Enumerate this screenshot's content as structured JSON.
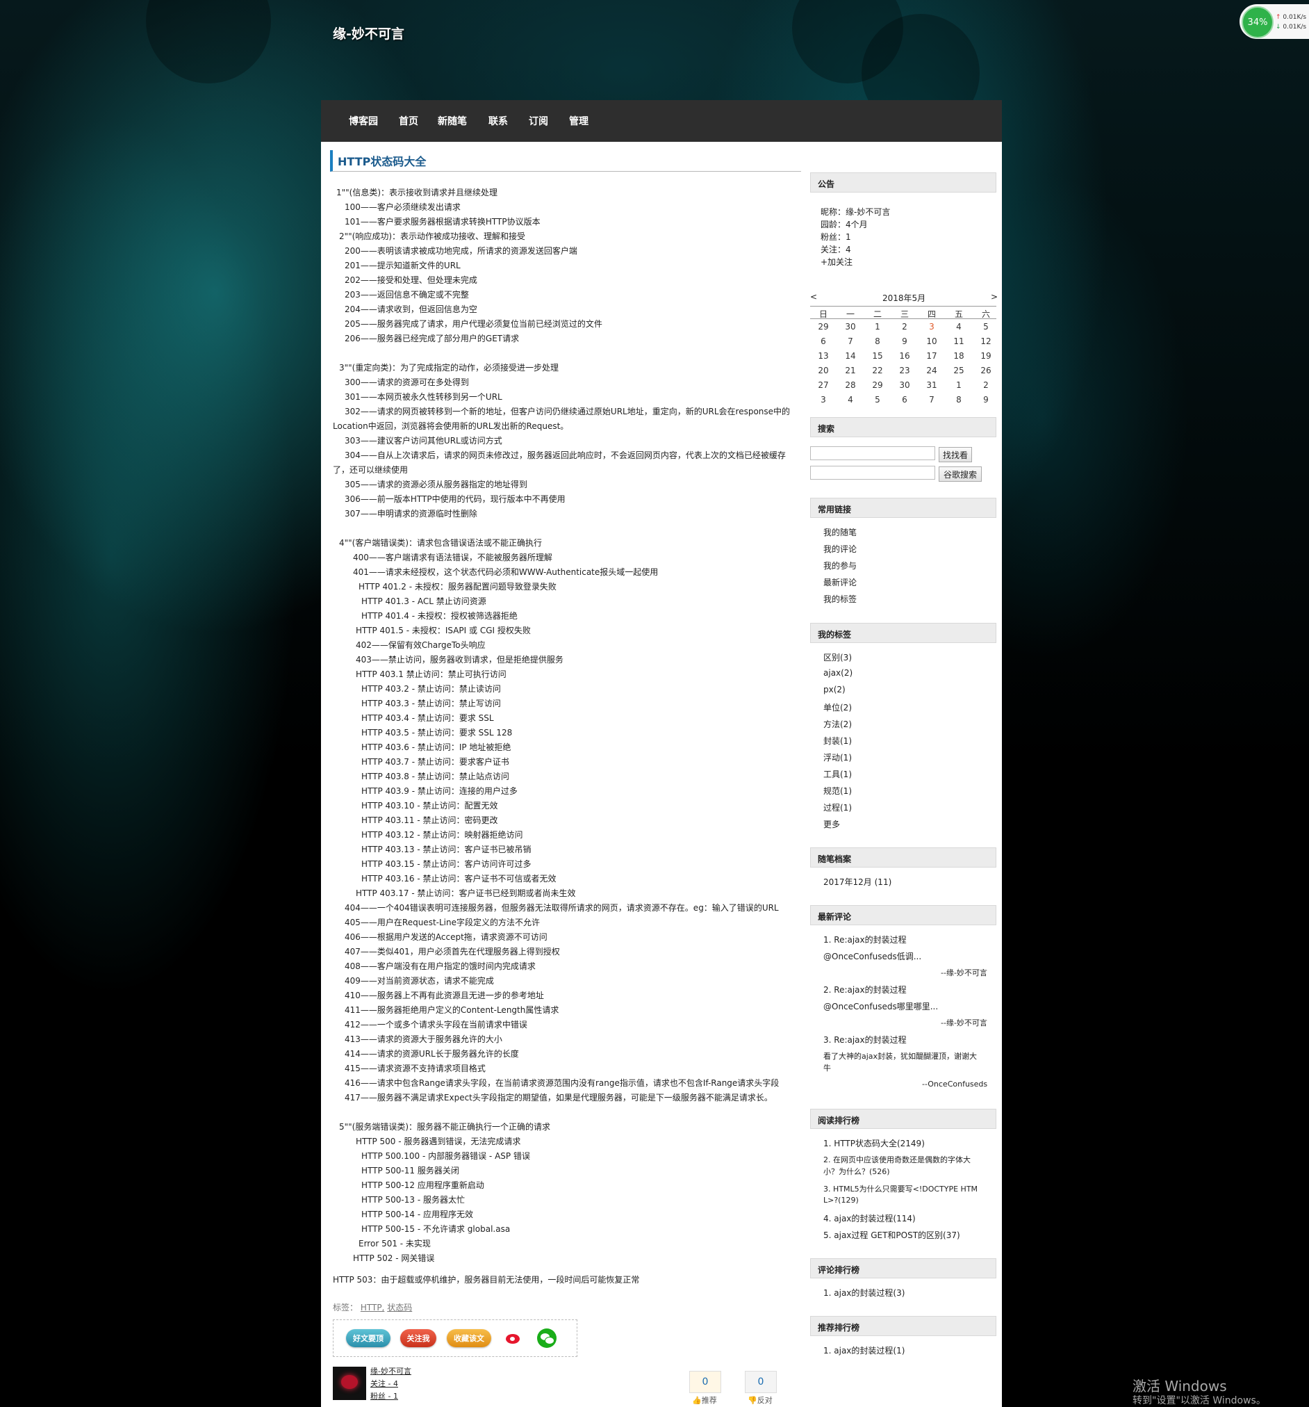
{
  "blog": {
    "title": "缘-妙不可言"
  },
  "netmon": {
    "percent": "34%",
    "up": "0.01K/s",
    "down": "0.01K/s"
  },
  "nav": [
    "博客园",
    "首页",
    "新随笔",
    "联系",
    "订阅",
    "管理"
  ],
  "post": {
    "title": "HTTP状态码大全",
    "lines": [
      "1\"\"(信息类)：表示接收到请求并且继续处理",
      "100——客户必须继续发出请求",
      "101——客户要求服务器根据请求转换HTTP协议版本",
      "2\"\"(响应成功)：表示动作被成功接收、理解和接受",
      "200——表明该请求被成功地完成，所请求的资源发送回客户端",
      "201——提示知道新文件的URL",
      "202——接受和处理、但处理未完成",
      "203——返回信息不确定或不完整",
      "204——请求收到，但返回信息为空",
      "205——服务器完成了请求，用户代理必须复位当前已经浏览过的文件",
      "206——服务器已经完成了部分用户的GET请求",
      "3\"\"(重定向类)：为了完成指定的动作，必须接受进一步处理",
      "300——请求的资源可在多处得到",
      "301——本网页被永久性转移到另一个URL",
      "302——请求的网页被转移到一个新的地址，但客户访问仍继续通过原始URL地址，重定向，新的URL会在response中的",
      "Location中返回，浏览器将会使用新的URL发出新的Request。",
      "303——建议客户访问其他URL或访问方式",
      "304——自从上次请求后，请求的网页未修改过，服务器返回此响应时，不会返回网页内容，代表上次的文档已经被缓存",
      "了，还可以继续使用",
      "305——请求的资源必须从服务器指定的地址得到",
      "306——前一版本HTTP中使用的代码，现行版本中不再使用",
      "307——申明请求的资源临时性删除",
      "4\"\"(客户端错误类)：请求包含错误语法或不能正确执行",
      "400——客户端请求有语法错误，不能被服务器所理解",
      "401——请求未经授权，这个状态代码必须和WWW-Authenticate报头域一起使用",
      "HTTP 401.2 - 未授权：服务器配置问题导致登录失败",
      "HTTP 401.3 - ACL 禁止访问资源",
      "HTTP 401.4 - 未授权：授权被筛选器拒绝",
      "HTTP 401.5 - 未授权：ISAPI 或 CGI 授权失败",
      "402——保留有效ChargeTo头响应",
      "403——禁止访问，服务器收到请求，但是拒绝提供服务",
      "HTTP 403.1 禁止访问：禁止可执行访问",
      "HTTP 403.2 - 禁止访问：禁止读访问",
      "HTTP 403.3 - 禁止访问：禁止写访问",
      "HTTP 403.4 - 禁止访问：要求 SSL",
      "HTTP 403.5 - 禁止访问：要求 SSL 128",
      "HTTP 403.6 - 禁止访问：IP 地址被拒绝",
      "HTTP 403.7 - 禁止访问：要求客户证书",
      "HTTP 403.8 - 禁止访问：禁止站点访问",
      "HTTP 403.9 - 禁止访问：连接的用户过多",
      "HTTP 403.10 - 禁止访问：配置无效",
      "HTTP 403.11 - 禁止访问：密码更改",
      "HTTP 403.12 - 禁止访问：映射器拒绝访问",
      "HTTP 403.13 - 禁止访问：客户证书已被吊销",
      "HTTP 403.15 - 禁止访问：客户访问许可过多",
      "HTTP 403.16 - 禁止访问：客户证书不可信或者无效",
      "HTTP 403.17 - 禁止访问：客户证书已经到期或者尚未生效",
      "404——一个404错误表明可连接服务器，但服务器无法取得所请求的网页，请求资源不存在。eg：输入了错误的URL",
      "405——用户在Request-Line字段定义的方法不允许",
      "406——根据用户发送的Accept拖，请求资源不可访问",
      "407——类似401，用户必须首先在代理服务器上得到授权",
      "408——客户端没有在用户指定的饿时间内完成请求",
      "409——对当前资源状态，请求不能完成",
      "410——服务器上不再有此资源且无进一步的参考地址",
      "411——服务器拒绝用户定义的Content-Length属性请求",
      "412——一个或多个请求头字段在当前请求中错误",
      "413——请求的资源大于服务器允许的大小",
      "414——请求的资源URL长于服务器允许的长度",
      "415——请求资源不支持请求项目格式",
      "416——请求中包含Range请求头字段，在当前请求资源范围内没有range指示值，请求也不包含If-Range请求头字段",
      "417——服务器不满足请求Expect头字段指定的期望值，如果是代理服务器，可能是下一级服务器不能满足请求长。",
      "5\"\"(服务端错误类)：服务器不能正确执行一个正确的请求",
      "HTTP 500 - 服务器遇到错误，无法完成请求",
      "HTTP 500.100 - 内部服务器错误 - ASP 错误",
      "HTTP 500-11 服务器关闭",
      "HTTP 500-12 应用程序重新启动",
      "HTTP 500-13 - 服务器太忙",
      "HTTP 500-14 - 应用程序无效",
      "HTTP 500-15 - 不允许请求 global.asa",
      "Error 501 - 未实现",
      "HTTP 502 - 网关错误",
      "HTTP 503：由于超载或停机维护，服务器目前无法使用，一段时间后可能恢复正常"
    ],
    "tags_label": "标签：",
    "tags": [
      "HTTP,",
      "状态码"
    ]
  },
  "share": {
    "good": "好文要顶",
    "follow": "关注我",
    "fav": "收藏该文",
    "weibo_icon": "weibo-icon",
    "wechat_icon": "wechat-icon"
  },
  "author": {
    "name": "缘-妙不可言",
    "follow": "关注 - 4",
    "fans": "粉丝 - 1"
  },
  "vote": {
    "up_count": "0",
    "up_label": "推荐",
    "down_count": "0",
    "down_label": "反对"
  },
  "sidebar": {
    "notice": {
      "title": "公告",
      "lines": [
        "昵称：缘-妙不可言",
        "园龄：4个月",
        "粉丝：1",
        "关注：4",
        "+加关注"
      ]
    },
    "calendar": {
      "prev": "<",
      "next": ">",
      "title": "2018年5月",
      "weekdays": [
        "日",
        "一",
        "二",
        "三",
        "四",
        "五",
        "六"
      ],
      "weeks": [
        [
          "29",
          "30",
          "1",
          "2",
          "3",
          "4",
          "5"
        ],
        [
          "6",
          "7",
          "8",
          "9",
          "10",
          "11",
          "12"
        ],
        [
          "13",
          "14",
          "15",
          "16",
          "17",
          "18",
          "19"
        ],
        [
          "20",
          "21",
          "22",
          "23",
          "24",
          "25",
          "26"
        ],
        [
          "27",
          "28",
          "29",
          "30",
          "31",
          "1",
          "2"
        ],
        [
          "3",
          "4",
          "5",
          "6",
          "7",
          "8",
          "9"
        ]
      ],
      "today": "3"
    },
    "search": {
      "title": "搜索",
      "btn1": "找找看",
      "btn2": "谷歌搜索"
    },
    "links": {
      "title": "常用链接",
      "items": [
        "我的随笔",
        "我的评论",
        "我的参与",
        "最新评论",
        "我的标签"
      ]
    },
    "mytags": {
      "title": "我的标签",
      "items": [
        "区别(3)",
        "ajax(2)",
        "px(2)",
        "单位(2)",
        "方法(2)",
        "封装(1)",
        "浮动(1)",
        "工具(1)",
        "规范(1)",
        "过程(1)",
        "更多"
      ]
    },
    "archive": {
      "title": "随笔档案",
      "items": [
        "2017年12月 (11)"
      ]
    },
    "comments": {
      "title": "最新评论",
      "items": [
        {
          "title": "1. Re:ajax的封装过程",
          "body": "@OnceConfuseds低调...",
          "author": "--缘-妙不可言"
        },
        {
          "title": "2. Re:ajax的封装过程",
          "body": "@OnceConfuseds哪里哪里...",
          "author": "--缘-妙不可言"
        },
        {
          "title": "3. Re:ajax的封装过程",
          "body": "看了大神的ajax封装，犹如醍醐灌顶，谢谢大",
          "body2": "牛",
          "author": "--OnceConfuseds"
        }
      ]
    },
    "readrank": {
      "title": "阅读排行榜",
      "items": [
        "1. HTTP状态码大全(2149)",
        "2. 在网页中应该使用奇数还是偶数的字体大",
        "小？为什么？(526)",
        "3. HTML5为什么只需要写<!DOCTYPE HTM",
        "L>?(129)",
        "4. ajax的封装过程(114)",
        "5. ajax过程 GET和POST的区别(37)"
      ]
    },
    "commentrank": {
      "title": "评论排行榜",
      "items": [
        "1. ajax的封装过程(3)"
      ]
    },
    "recommendrank": {
      "title": "推荐排行榜",
      "items": [
        "1. ajax的封装过程(1)"
      ]
    }
  },
  "watermark": {
    "line1": "激活 Windows",
    "line2": "转到\"设置\"以激活 Windows。"
  }
}
